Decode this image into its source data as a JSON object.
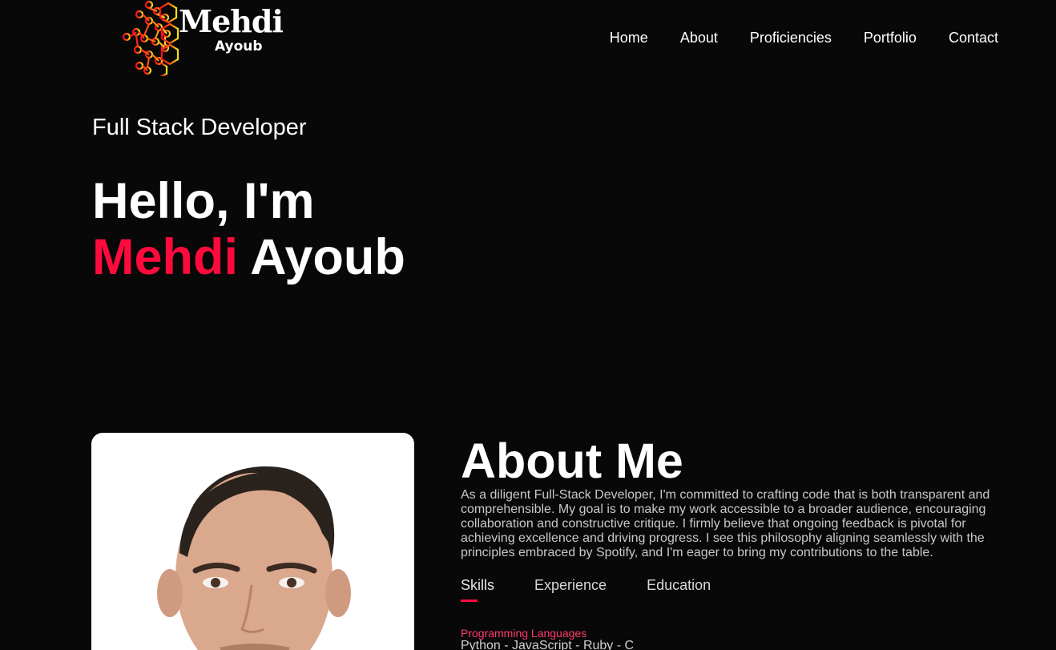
{
  "header": {
    "logo": {
      "title": "Mehdi",
      "subtitle": "Ayoub"
    },
    "nav": [
      {
        "label": "Home"
      },
      {
        "label": "About"
      },
      {
        "label": "Proficiencies"
      },
      {
        "label": "Portfolio"
      },
      {
        "label": "Contact"
      }
    ]
  },
  "hero": {
    "subtitle": "Full Stack Developer",
    "greeting": "Hello, I'm",
    "first_name": "Mehdi",
    "last_name": "Ayoub"
  },
  "about": {
    "title": "About Me",
    "text": "As a diligent Full-Stack Developer, I'm committed to crafting code that is both transparent and comprehensible. My goal is to make my work accessible to a broader audience, encouraging collaboration and constructive critique. I firmly believe that ongoing feedback is pivotal for achieving excellence and driving progress. I see this philosophy aligning seamlessly with the principles embraced by Spotify, and I'm eager to bring my contributions to the table.",
    "tabs": [
      {
        "label": "Skills"
      },
      {
        "label": "Experience"
      },
      {
        "label": "Education"
      }
    ],
    "skills": {
      "category": "Programming Languages",
      "items": "Python - JavaScript - Ruby - C"
    }
  },
  "colors": {
    "background": "#080808",
    "accent": "#ff0a3c",
    "logo_yellow": "#f2e61a"
  },
  "icons": {
    "logo_mark": "hexagon-network-icon",
    "photo": "profile-avatar"
  }
}
